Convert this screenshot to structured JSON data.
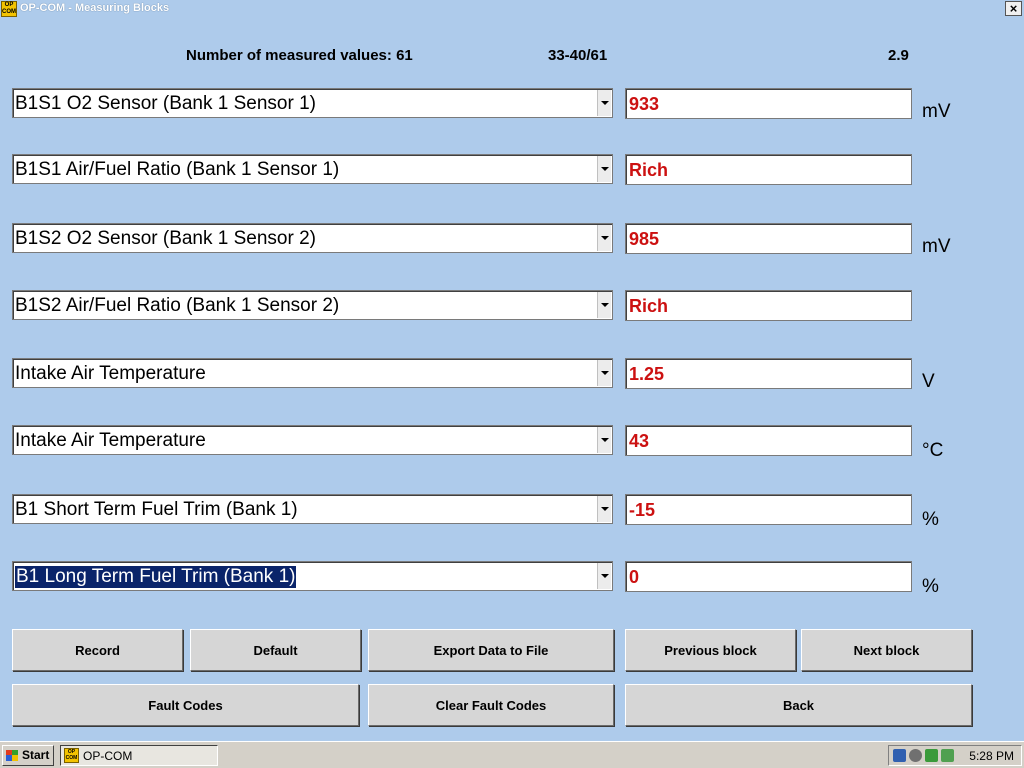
{
  "window": {
    "title": "OP-COM - Measuring Blocks",
    "app_icon_text": [
      "OP",
      "COM"
    ],
    "close_label": "×"
  },
  "info": {
    "measured_label": "Number of measured values: 61",
    "block_range": "33-40/61",
    "version": "2.9"
  },
  "rows": [
    {
      "name": "B1S1 O2 Sensor (Bank 1 Sensor 1)",
      "value": "933",
      "unit": "mV"
    },
    {
      "name": "B1S1 Air/Fuel Ratio (Bank 1 Sensor 1)",
      "value": "Rich",
      "unit": ""
    },
    {
      "name": "B1S2 O2 Sensor (Bank 1 Sensor 2)",
      "value": "985",
      "unit": "mV"
    },
    {
      "name": "B1S2 Air/Fuel Ratio (Bank 1 Sensor 2)",
      "value": "Rich",
      "unit": ""
    },
    {
      "name": "Intake Air Temperature",
      "value": "1.25",
      "unit": "V"
    },
    {
      "name": "Intake Air Temperature",
      "value": "43",
      "unit": "°C"
    },
    {
      "name": "B1 Short Term Fuel Trim (Bank 1)",
      "value": "-15",
      "unit": "%"
    },
    {
      "name": "B1 Long Term Fuel Trim (Bank 1)",
      "value": "0",
      "unit": "%",
      "selected": true
    }
  ],
  "buttons": {
    "record": "Record",
    "default": "Default",
    "export": "Export Data to File",
    "previous_block": "Previous block",
    "next_block": "Next block",
    "fault_codes": "Fault Codes",
    "clear_fault_codes": "Clear Fault Codes",
    "back": "Back"
  },
  "taskbar": {
    "start_label": "Start",
    "task_label": "OP-COM",
    "clock": "5:28 PM",
    "tray_icons": [
      "network-icon",
      "volume-icon",
      "security-icon",
      "usb-icon"
    ]
  },
  "colors": {
    "background": "#aecbeb",
    "value_text": "#cc1111",
    "selection": "#0a246a"
  }
}
